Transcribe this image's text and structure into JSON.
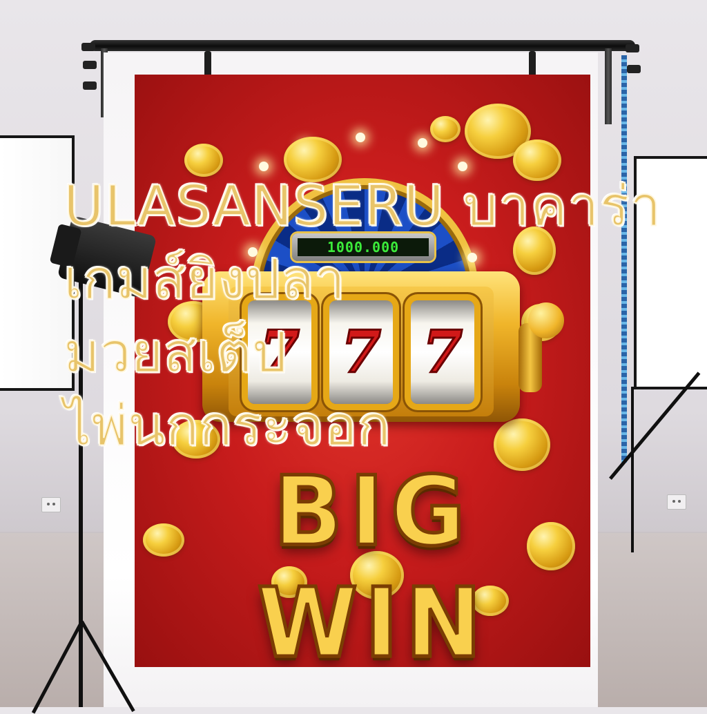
{
  "overlay_lines": [
    "ULASANSERU บาคาร่า",
    "เกมส์ยิงปลา",
    "มวยสเต็ป",
    "ไพ่นกกระจอก"
  ],
  "backdrop": {
    "reels": [
      "7",
      "7",
      "7"
    ],
    "banner": "BIG WIN",
    "counter": "1000.000"
  },
  "colors": {
    "backdrop_red": "#c81c1c",
    "gold": "#f0b52a",
    "overlay_text": "#e8c46a"
  },
  "icons": [
    "slot-machine-icon",
    "gold-coin-icon",
    "softbox-light-icon",
    "studio-strobe-icon"
  ]
}
